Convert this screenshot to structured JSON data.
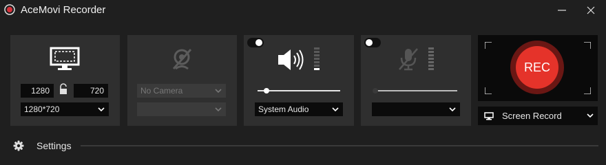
{
  "app": {
    "title": "AceMovi Recorder"
  },
  "screen": {
    "width": "1280",
    "height": "720",
    "resolution": "1280*720"
  },
  "camera": {
    "device": "No Camera",
    "format": ""
  },
  "system_audio": {
    "enabled": true,
    "volume_level": 0.08,
    "device": "System Audio",
    "meter_lit_segments": 1
  },
  "microphone": {
    "enabled": false,
    "volume_level": 0.0,
    "device": ""
  },
  "record": {
    "label": "REC",
    "mode": "Screen Record"
  },
  "settings": {
    "label": "Settings"
  },
  "colors": {
    "background": "#1f1f1f",
    "panel": "#2f2f2f",
    "rec_red": "#e5332a",
    "accent_dark_red": "#6a1714"
  }
}
